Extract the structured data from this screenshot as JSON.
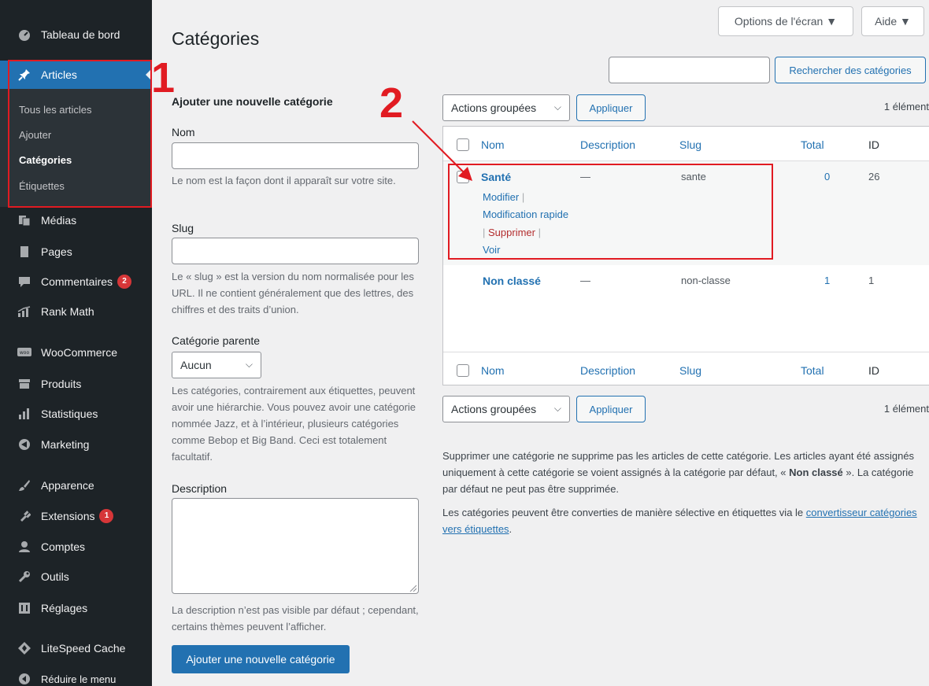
{
  "sidebar": {
    "items": [
      {
        "label": "Tableau de bord",
        "icon": "dashboard-icon"
      },
      {
        "label": "Articles",
        "icon": "pin-icon"
      },
      {
        "label": "Médias",
        "icon": "media-icon"
      },
      {
        "label": "Pages",
        "icon": "pages-icon"
      },
      {
        "label": "Commentaires",
        "icon": "comments-icon",
        "badge": "2"
      },
      {
        "label": "Rank Math",
        "icon": "rank-math-icon"
      },
      {
        "label": "WooCommerce",
        "icon": "woocommerce-icon"
      },
      {
        "label": "Produits",
        "icon": "products-icon"
      },
      {
        "label": "Statistiques",
        "icon": "stats-icon"
      },
      {
        "label": "Marketing",
        "icon": "megaphone-icon"
      },
      {
        "label": "Apparence",
        "icon": "brush-icon"
      },
      {
        "label": "Extensions",
        "icon": "plugins-icon",
        "badge": "1"
      },
      {
        "label": "Comptes",
        "icon": "users-icon"
      },
      {
        "label": "Outils",
        "icon": "wrench-icon"
      },
      {
        "label": "Réglages",
        "icon": "settings-icon"
      },
      {
        "label": "LiteSpeed Cache",
        "icon": "litespeed-icon"
      },
      {
        "label": "Réduire le menu",
        "icon": "collapse-icon"
      }
    ],
    "submenu": [
      "Tous les articles",
      "Ajouter",
      "Catégories",
      "Étiquettes"
    ]
  },
  "annotations": {
    "one": "1",
    "two": "2",
    "color": "#e11b22"
  },
  "header": {
    "screen_options": "Options de l'écran ▼",
    "help": "Aide ▼",
    "title": "Catégories"
  },
  "search": {
    "button": "Rechercher des catégories",
    "value": ""
  },
  "form": {
    "heading": "Ajouter une nouvelle catégorie",
    "name_label": "Nom",
    "name_help": "Le nom est la façon dont il apparaît sur votre site.",
    "slug_label": "Slug",
    "slug_help": "Le « slug » est la version du nom normalisée pour les URL. Il ne contient généralement que des lettres, des chiffres et des traits d’union.",
    "parent_label": "Catégorie parente",
    "parent_value": "Aucun",
    "parent_help": "Les catégories, contrairement aux étiquettes, peuvent avoir une hiérarchie. Vous pouvez avoir une catégorie nommée Jazz, et à l’intérieur, plusieurs catégories comme Bebop et Big Band. Ceci est totalement facultatif.",
    "description_label": "Description",
    "description_help": "La description n’est pas visible par défaut ; cependant, certains thèmes peuvent l’afficher.",
    "submit": "Ajouter une nouvelle catégorie"
  },
  "bulk": {
    "select": "Actions groupées",
    "apply": "Appliquer",
    "count": "1 élément"
  },
  "table": {
    "columns": {
      "name": "Nom",
      "description": "Description",
      "slug": "Slug",
      "total": "Total",
      "id": "ID"
    },
    "rows": [
      {
        "name": "Santé",
        "description": "—",
        "slug": "sante",
        "total": "0",
        "id": "26",
        "actions": {
          "edit": "Modifier",
          "quick_edit": "Modification rapide",
          "delete": "Supprimer",
          "view": "Voir"
        }
      },
      {
        "name": "Non classé",
        "description": "—",
        "slug": "non-classe",
        "total": "1",
        "id": "1"
      }
    ]
  },
  "notes": {
    "p1_before": "Supprimer une catégorie ne supprime pas les articles de cette catégorie. Les articles ayant été assignés uniquement à cette catégorie se voient assignés à la catégorie par défaut, « ",
    "p1_bold": "Non classé",
    "p1_after": " ». La catégorie par défaut ne peut pas être supprimée.",
    "p2_before": "Les catégories peuvent être converties de manière sélective en étiquettes via le ",
    "p2_link": "convertisseur catégories vers étiquettes",
    "p2_after": "."
  }
}
